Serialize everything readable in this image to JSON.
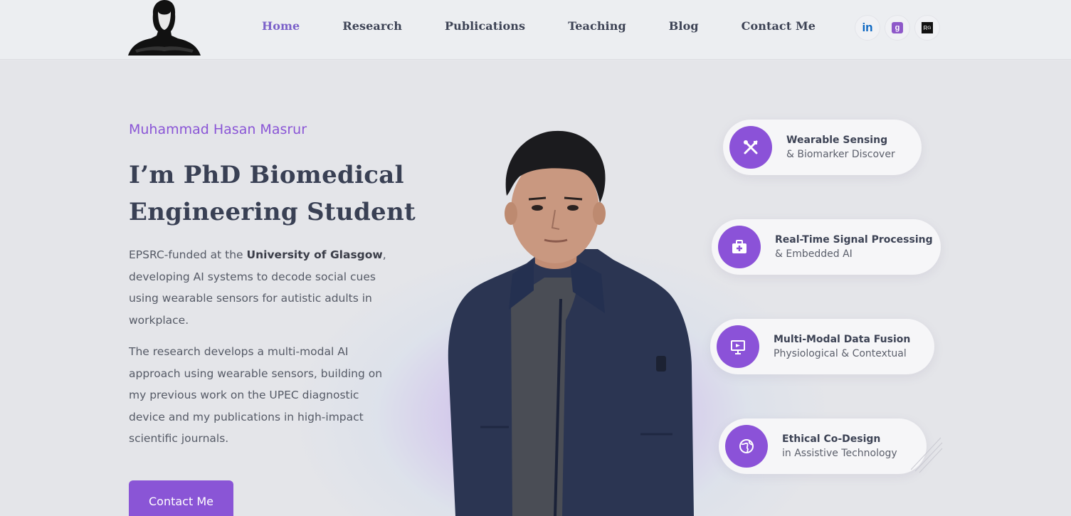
{
  "nav": {
    "items": [
      "Home",
      "Research",
      "Publications",
      "Teaching",
      "Blog",
      "Contact Me"
    ],
    "active": "Home"
  },
  "social": {
    "linkedin_label": "in",
    "scholar_label": "g"
  },
  "hero": {
    "name": "Muhammad Hasan Masrur",
    "headline_line1": "I’m PhD Biomedical",
    "headline_line2": "Engineering Student",
    "para1_pre": "EPSRC-funded at the ",
    "para1_bold": "University of Glasgow",
    "para1_post": ", developing AI systems to decode social cues using wearable sensors for autistic adults in workplace.",
    "para2": "The research develops a multi-modal AI approach using wearable sensors, building on my previous work on the UPEC diagnostic device and my publications in high-impact scientific journals.",
    "cta_label": "Contact Me"
  },
  "features": [
    {
      "title": "Wearable Sensing",
      "subtitle": "& Biomarker Discover",
      "icon": "tools-icon"
    },
    {
      "title": "Real-Time Signal Processing",
      "subtitle": "& Embedded AI",
      "icon": "medical-kit-icon"
    },
    {
      "title": "Multi-Modal Data Fusion",
      "subtitle": "Physiological & Contextual",
      "icon": "presentation-icon"
    },
    {
      "title": "Ethical Co-Design",
      "subtitle": "in Assistive Technology",
      "icon": "globe-icon"
    }
  ],
  "colors": {
    "accent": "#8a55d6",
    "heading": "#394054",
    "nav_active": "#7b61c9"
  }
}
